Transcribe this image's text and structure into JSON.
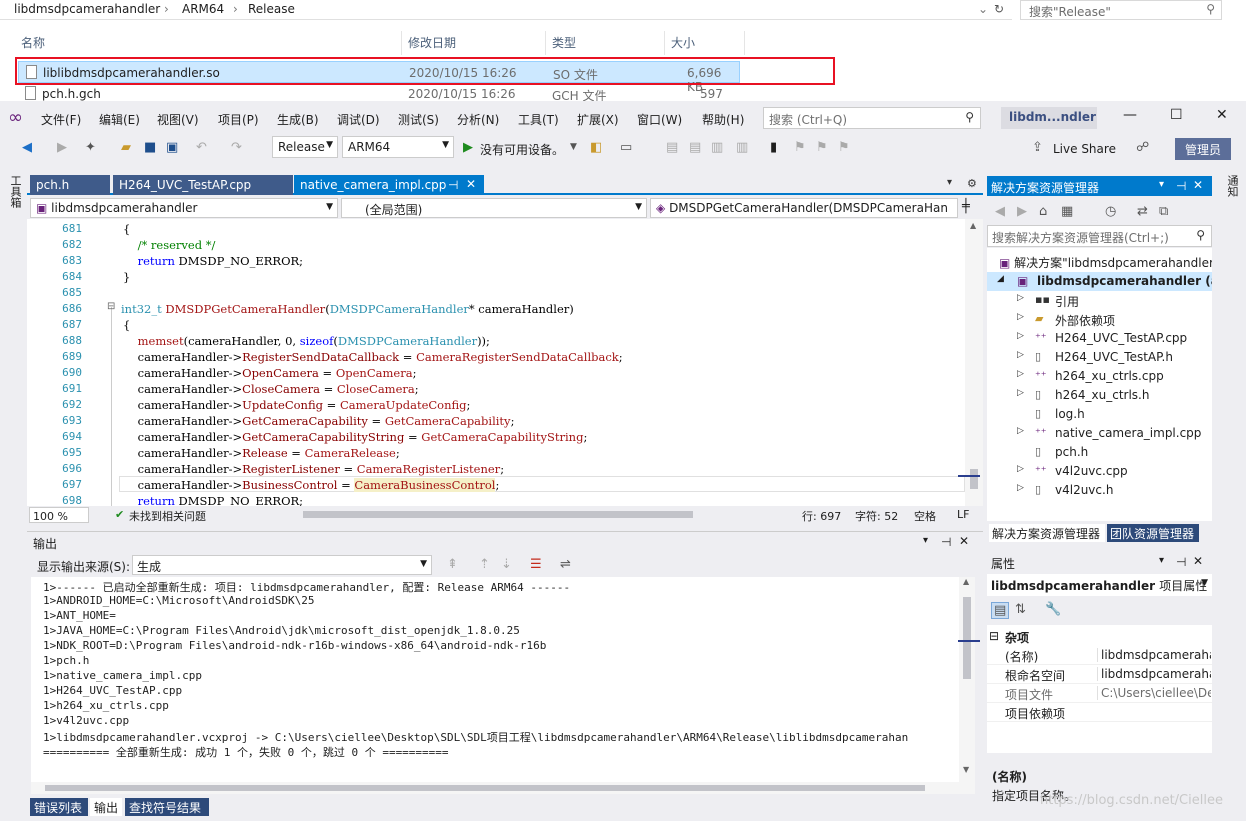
{
  "explorer": {
    "breadcrumb": [
      "libdmsdpcamerahandler",
      "ARM64",
      "Release"
    ],
    "search_placeholder": "搜索\"Release\"",
    "columns": [
      "名称",
      "修改日期",
      "类型",
      "大小"
    ],
    "files": [
      {
        "name": "liblibdmsdpcamerahandler.so",
        "date": "2020/10/15 16:26",
        "type": "SO 文件",
        "size": "6,696 KB"
      },
      {
        "name": "pch.h.gch",
        "date": "2020/10/15 16:26",
        "type": "GCH 文件",
        "size": "597 KB"
      }
    ]
  },
  "vs": {
    "menu": [
      "文件(F)",
      "编辑(E)",
      "视图(V)",
      "项目(P)",
      "生成(B)",
      "调试(D)",
      "测试(S)",
      "分析(N)",
      "工具(T)",
      "扩展(X)",
      "窗口(W)",
      "帮助(H)"
    ],
    "search_placeholder": "搜索 (Ctrl+Q)",
    "title": "libdm...ndler",
    "config": "Release",
    "platform": "ARM64",
    "run_label": "没有可用设备。",
    "live_share": "Live Share",
    "admin": "管理员",
    "left_strip": "工具箱",
    "right_strip": "通知",
    "tabs": [
      "pch.h",
      "H264_UVC_TestAP.cpp",
      "native_camera_impl.cpp"
    ],
    "nav": [
      "libdmsdpcamerahandler",
      "(全局范围)",
      "DMSDPGetCameraHandler(DMSDPCameraHan"
    ],
    "line_numbers": [
      "681",
      "682",
      "683",
      "684",
      "685",
      "686",
      "687",
      "688",
      "689",
      "690",
      "691",
      "692",
      "693",
      "694",
      "695",
      "696",
      "697",
      "698"
    ],
    "status": {
      "zoom": "100 %",
      "issues": "未找到相关问题",
      "line": "行: 697",
      "col": "字符: 52",
      "ws": "空格",
      "eol": "LF"
    }
  },
  "output": {
    "title": "输出",
    "source_label": "显示输出来源(S):",
    "source_value": "生成",
    "lines": [
      "1>------ 已启动全部重新生成: 项目: libdmsdpcamerahandler, 配置: Release ARM64 ------",
      "1>ANDROID_HOME=C:\\Microsoft\\AndroidSDK\\25",
      "1>ANT_HOME=",
      "1>JAVA_HOME=C:\\Program Files\\Android\\jdk\\microsoft_dist_openjdk_1.8.0.25",
      "1>NDK_ROOT=D:\\Program Files\\android-ndk-r16b-windows-x86_64\\android-ndk-r16b",
      "1>pch.h",
      "1>native_camera_impl.cpp",
      "1>H264_UVC_TestAP.cpp",
      "1>h264_xu_ctrls.cpp",
      "1>v4l2uvc.cpp",
      "1>libdmsdpcamerahandler.vcxproj -> C:\\Users\\ciellee\\Desktop\\SDL\\SDL项目工程\\libdmsdpcamerahandler\\ARM64\\Release\\liblibdmsdpcamerahan",
      "========== 全部重新生成: 成功 1 个，失败 0 个，跳过 0 个 =========="
    ],
    "bottom_tabs": [
      "错误列表",
      "输出",
      "查找符号结果"
    ]
  },
  "solution": {
    "title": "解决方案资源管理器",
    "search_placeholder": "搜索解决方案资源管理器(Ctrl+;)",
    "root": "解决方案\"libdmsdpcamerahandler",
    "project": "libdmsdpcamerahandler (and",
    "items": [
      "引用",
      "外部依赖项",
      "H264_UVC_TestAP.cpp",
      "H264_UVC_TestAP.h",
      "h264_xu_ctrls.cpp",
      "h264_xu_ctrls.h",
      "log.h",
      "native_camera_impl.cpp",
      "pch.h",
      "v4l2uvc.cpp",
      "v4l2uvc.h"
    ],
    "tabs": [
      "解决方案资源管理器",
      "团队资源管理器"
    ]
  },
  "properties": {
    "title": "属性",
    "object": "libdmsdpcamerahandler",
    "object_type": "项目属性",
    "category": "杂项",
    "rows": [
      {
        "name": "(名称)",
        "value": "libdmsdpcameraha"
      },
      {
        "name": "根命名空间",
        "value": "libdmsdpcameraha"
      },
      {
        "name": "项目文件",
        "value": "C:\\Users\\ciellee\\Des"
      },
      {
        "name": "项目依赖项",
        "value": ""
      }
    ],
    "desc_title": "(名称)",
    "desc_text": "指定项目名称。"
  },
  "watermark": "https://blog.csdn.net/Ciellee",
  "colors": {
    "accent": "#007acc",
    "highlight": "#e81123"
  }
}
